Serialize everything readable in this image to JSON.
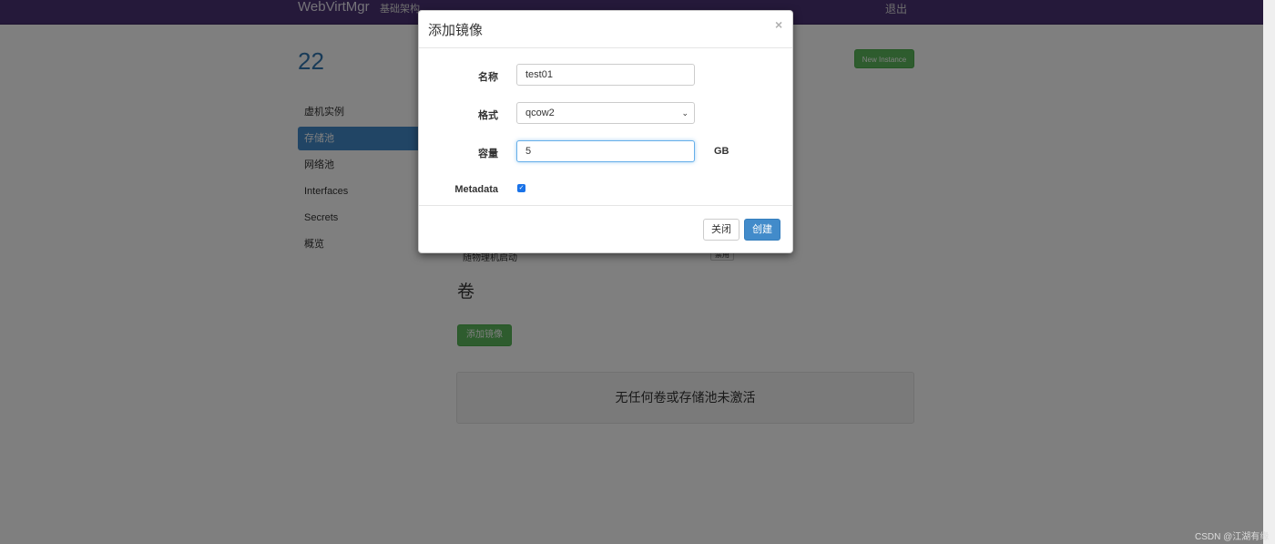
{
  "navbar": {
    "brand": "WebVirtMgr",
    "infrastructure": "基础架构",
    "logout": "退出"
  },
  "page": {
    "title": "22",
    "new_instance": "New Instance",
    "volumes_heading": "卷",
    "add_image": "添加镜像",
    "empty_message": "无任何卷或存储池未激活",
    "partial_row_text": "随物理机启动",
    "partial_row_button": "禁用"
  },
  "sidebar": {
    "items": [
      {
        "label": "虚机实例",
        "active": false
      },
      {
        "label": "存储池",
        "active": true
      },
      {
        "label": "网络池",
        "active": false
      },
      {
        "label": "Interfaces",
        "active": false
      },
      {
        "label": "Secrets",
        "active": false
      },
      {
        "label": "概览",
        "active": false
      }
    ]
  },
  "modal": {
    "title": "添加镜像",
    "close_symbol": "×",
    "name_label": "名称",
    "name_value": "test01",
    "format_label": "格式",
    "format_value": "qcow2",
    "capacity_label": "容量",
    "capacity_value": "5",
    "capacity_unit": "GB",
    "metadata_label": "Metadata",
    "metadata_checked": true,
    "close_button": "关闭",
    "create_button": "创建"
  },
  "watermark": "CSDN @江湖有缘",
  "colors": {
    "navbar": "#4a3274",
    "primary": "#428bca",
    "success": "#5cb85c"
  }
}
